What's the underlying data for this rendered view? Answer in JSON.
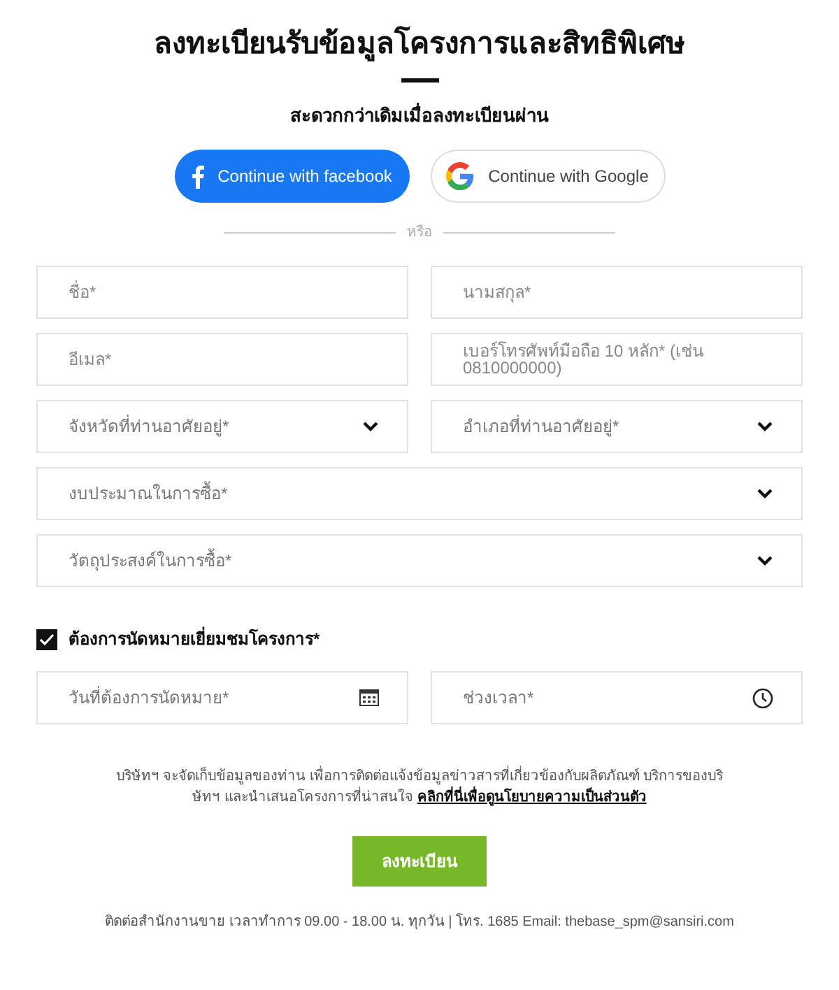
{
  "title": "ลงทะเบียนรับข้อมูลโครงการและสิทธิพิเศษ",
  "subtitle": "สะดวกกว่าเดิมเมื่อลงทะเบียนผ่าน",
  "social_buttons": [
    {
      "kind": "facebook",
      "label": "Continue with facebook"
    },
    {
      "kind": "google",
      "label": "Continue with Google"
    }
  ],
  "divider": "หรือ",
  "field_rows": [
    [
      {
        "kind": "text",
        "placeholder": "ชื่อ*"
      },
      {
        "kind": "text",
        "placeholder": "นามสกุล*"
      }
    ],
    [
      {
        "kind": "text",
        "placeholder": "อีเมล*"
      },
      {
        "kind": "multiline",
        "placeholder": "เบอร์โทรศัพท์มือถือ 10 หลัก* (เช่น 0810000000)"
      }
    ],
    [
      {
        "kind": "select",
        "placeholder": "จังหวัดที่ท่านอาศัยอยู่*"
      },
      {
        "kind": "select",
        "placeholder": "อำเภอที่ท่านอาศัยอยู่*"
      }
    ],
    [
      {
        "kind": "select",
        "placeholder": "งบประมาณในการซื้อ*"
      }
    ],
    [
      {
        "kind": "select",
        "placeholder": "วัตถุประสงค์ในการซื้อ*"
      }
    ]
  ],
  "appointment": {
    "label": "ต้องการนัดหมายเยี่ยมชมโครงการ*",
    "checked": true
  },
  "appointment_fields": [
    {
      "kind": "date",
      "placeholder": "วันที่ต้องการนัดหมาย*"
    },
    {
      "kind": "time",
      "placeholder": "ช่วงเวลา*"
    }
  ],
  "privacy": {
    "text": "บริษัทฯ จะจัดเก็บข้อมูลของท่าน เพื่อการติดต่อแจ้งข้อมูลข่าวสารที่เกี่ยวข้องกับผลิตภัณฑ์ บริการของบริษัทฯ และนำเสนอโครงการที่น่าสนใจ",
    "link": "คลิกที่นี่เพื่อดูนโยบายความเป็นส่วนตัว"
  },
  "submit": "ลงทะเบียน",
  "footer": "ติดต่อสำนักงานขาย เวลาทำการ 09.00 - 18.00 น. ทุกวัน | โทร. 1685 Email: thebase_spm@sansiri.com"
}
